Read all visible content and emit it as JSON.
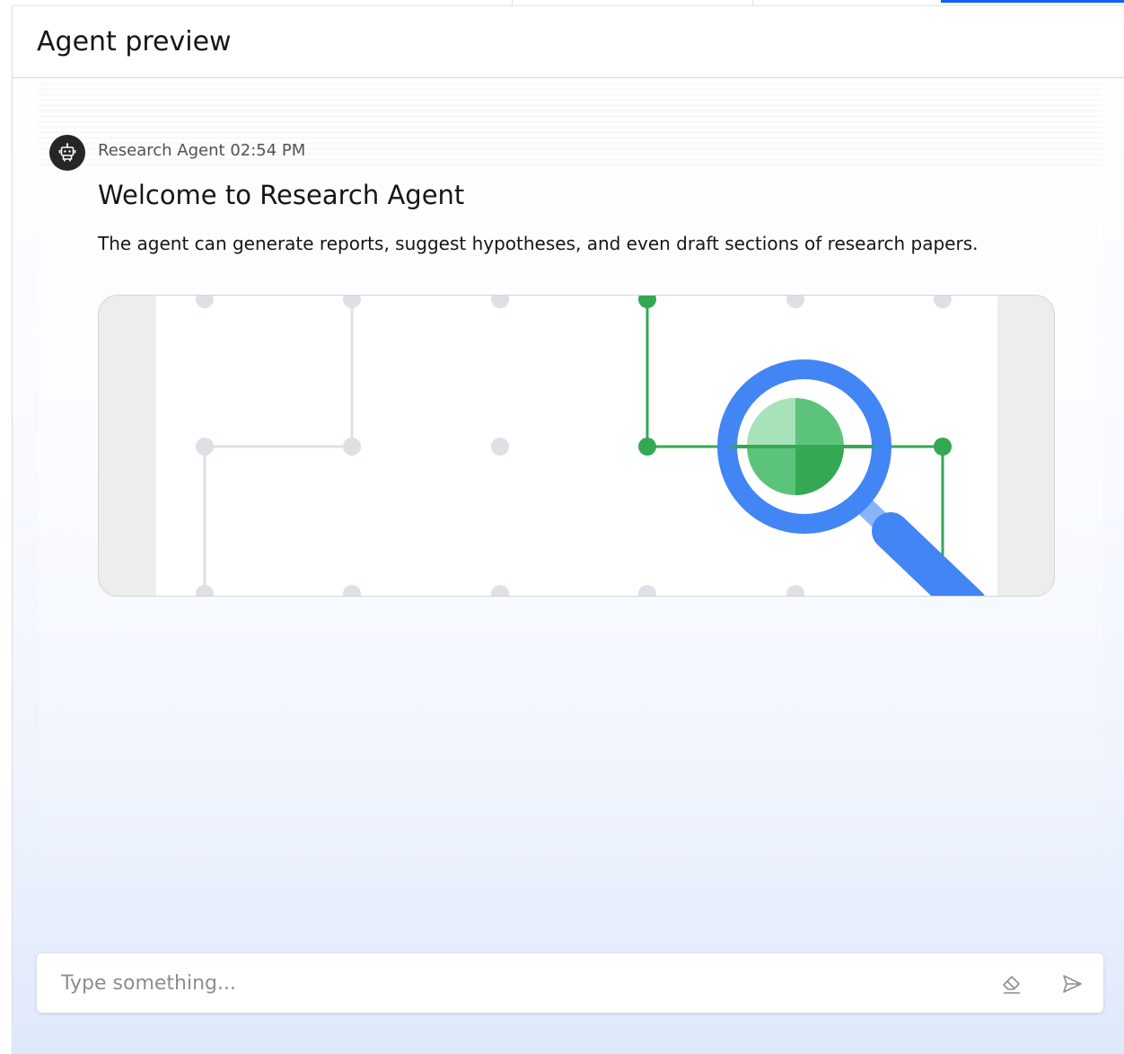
{
  "header": {
    "title": "Agent preview"
  },
  "message": {
    "sender": "Research Agent",
    "time": "02:54 PM",
    "title": "Welcome to Research Agent",
    "body": "The agent can generate reports, suggest hypotheses, and even draft sections of research papers.",
    "avatar_icon": "robot-icon",
    "image_icon": "magnifying-glass-network-illustration"
  },
  "input": {
    "placeholder": "Type something...",
    "value": "",
    "clear_icon": "eraser-icon",
    "send_icon": "send-icon"
  },
  "colors": {
    "accent": "#0f62fe",
    "magnifier_blue": "#4285f4",
    "network_green": "#34a853",
    "avatar_bg": "#262626"
  }
}
